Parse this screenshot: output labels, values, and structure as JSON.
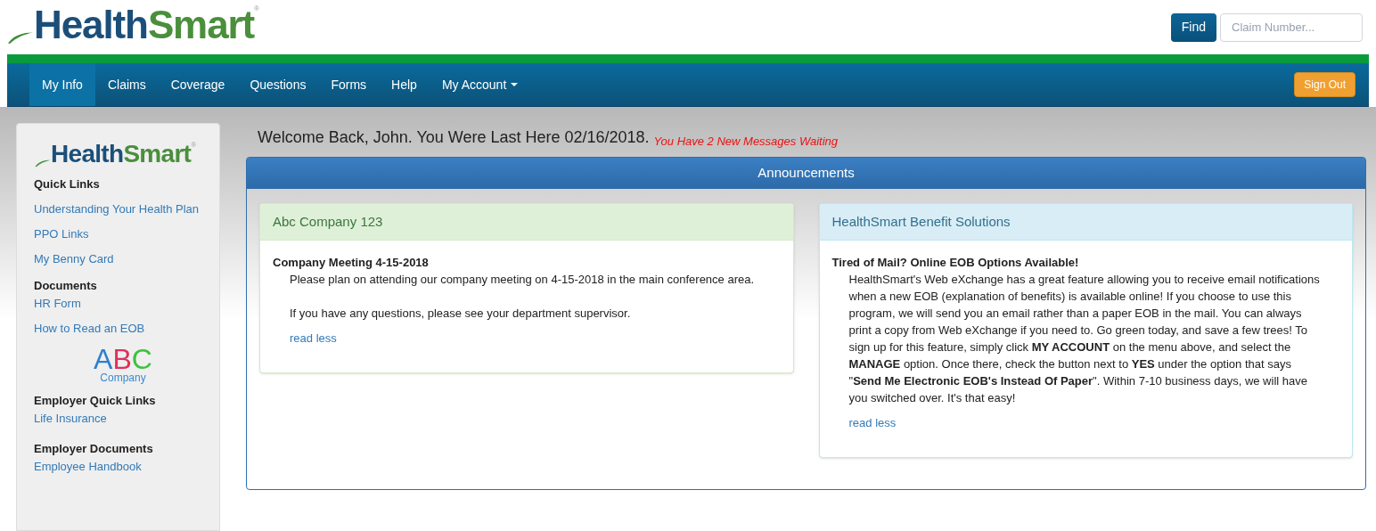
{
  "header": {
    "logo": {
      "part_1": "Health",
      "part_2": "Smart",
      "mark": "®"
    },
    "find_button": "Find",
    "claim_search": {
      "placeholder": "Claim Number..."
    }
  },
  "nav": {
    "items": [
      {
        "label": "My Info",
        "selected": true,
        "dropdown": false
      },
      {
        "label": "Claims",
        "selected": false,
        "dropdown": false
      },
      {
        "label": "Coverage",
        "selected": false,
        "dropdown": false
      },
      {
        "label": "Questions",
        "selected": false,
        "dropdown": false
      },
      {
        "label": "Forms",
        "selected": false,
        "dropdown": false
      },
      {
        "label": "Help",
        "selected": false,
        "dropdown": false
      },
      {
        "label": "My Account",
        "selected": false,
        "dropdown": true
      }
    ],
    "sign_out": "Sign Out"
  },
  "sidebar": {
    "logo": {
      "part_1": "Health",
      "part_2": "Smart",
      "mark": "®"
    },
    "sections": [
      {
        "kind": "links",
        "heading": "Quick Links",
        "links": [
          "Understanding Your Health Plan",
          "PPO Links",
          "My Benny Card"
        ]
      },
      {
        "kind": "links",
        "heading": "Documents",
        "links": [
          "HR Form",
          "How to Read an EOB"
        ]
      },
      {
        "kind": "employer_logo",
        "letters": [
          {
            "text": "A",
            "color": "#2f7fd0"
          },
          {
            "text": "B",
            "color": "#e0305a"
          },
          {
            "text": "C",
            "color": "#3cc23c"
          }
        ],
        "caption": "Company"
      },
      {
        "kind": "links",
        "heading": "Employer Quick Links",
        "links": [
          "Life Insurance"
        ]
      },
      {
        "kind": "links",
        "heading": "Employer Documents",
        "links": [
          "Employee Handbook"
        ]
      }
    ]
  },
  "welcome": {
    "text": "Welcome Back, John. You Were Last Here 02/16/2018.",
    "messages": "You Have 2 New Messages Waiting"
  },
  "announcements": {
    "title": "Announcements",
    "panels": [
      {
        "kind": "employer",
        "title": "Abc Company 123",
        "heading": "Company Meeting 4-15-2018",
        "paragraphs": [
          "Please plan on attending our company meeting on 4-15-2018 in the main conference area.",
          "If you have any questions, please see your department supervisor."
        ],
        "link": "read less"
      },
      {
        "kind": "provider",
        "title": "HealthSmart Benefit Solutions",
        "heading": "Tired of Mail? Online EOB Options Available!",
        "paragraphs": [
          "HealthSmart's Web eXchange has a great feature allowing you to receive email notifications when a new EOB (explanation of benefits) is available online! If you choose to use this program, we will send you an email rather than a paper EOB in the mail. You can always print a copy from Web eXchange if you need to. Go green today, and save a few trees! To sign up for this feature, simply click **MY ACCOUNT** on the menu above, and select the **MANAGE** option. Once there, check the button next to **YES** under the option that says \"**Send Me Electronic EOB's Instead Of Paper**\". Within 7-10 business days, we will have you switched over. It's that easy!"
        ],
        "link": "read less"
      }
    ]
  }
}
